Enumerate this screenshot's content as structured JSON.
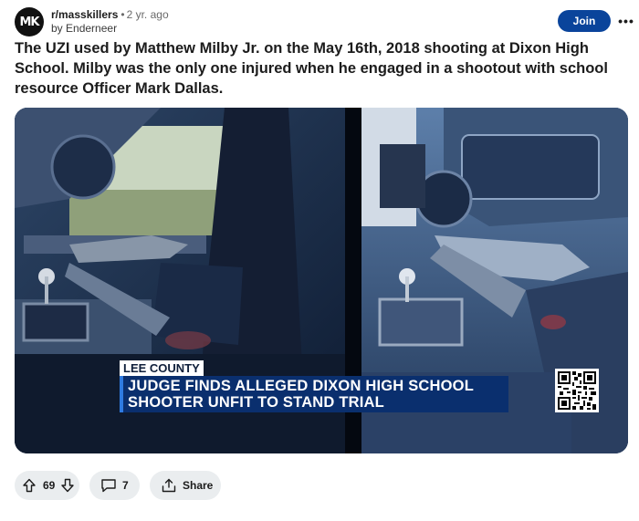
{
  "post": {
    "avatar_text": "MK",
    "subreddit": "r/masskillers",
    "separator": "•",
    "age": "2 yr. ago",
    "author_prefix": "by",
    "author": "Enderneer",
    "join_label": "Join",
    "more_label": "•••",
    "title": "The UZI used by Matthew Milby Jr. on the May 16th, 2018 shooting at Dixon High School. Milby was the only one injured when he engaged in a shootout with school resource Officer Mark Dallas."
  },
  "media": {
    "chyron_tag": "LEE COUNTY",
    "chyron_line1": "JUDGE FINDS ALLEGED DIXON HIGH SCHOOL",
    "chyron_line2": "SHOOTER UNFIT TO STAND TRIAL"
  },
  "actions": {
    "vote_count": "69",
    "comment_count": "7",
    "share_label": "Share"
  },
  "colors": {
    "join_button": "#0a449b",
    "pill_background": "#eaedef",
    "chyron_blue": "#0a2f6e"
  },
  "icons": [
    "upvote-icon",
    "downvote-icon",
    "comment-icon",
    "share-icon",
    "more-icon",
    "qr-code-icon"
  ]
}
